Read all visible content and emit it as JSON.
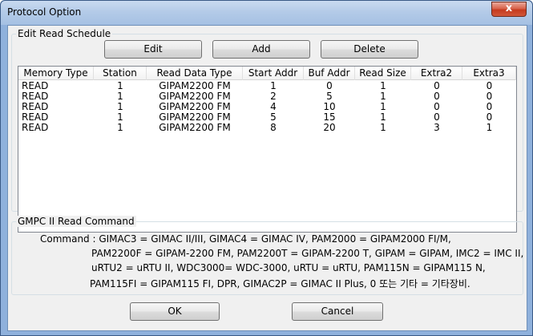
{
  "window": {
    "title": "Protocol Option",
    "close_label": "x"
  },
  "schedule": {
    "group_label": "Edit Read Schedule",
    "buttons": {
      "edit": "Edit",
      "add": "Add",
      "delete": "Delete"
    },
    "columns": [
      "Memory Type",
      "Station",
      "Read Data Type",
      "Start Addr",
      "Buf Addr",
      "Read Size",
      "Extra2",
      "Extra3"
    ],
    "rows": [
      [
        "READ",
        "1",
        "GIPAM2200 FM",
        "1",
        "0",
        "1",
        "0",
        "0"
      ],
      [
        "READ",
        "1",
        "GIPAM2200 FM",
        "2",
        "5",
        "1",
        "0",
        "0"
      ],
      [
        "READ",
        "1",
        "GIPAM2200 FM",
        "4",
        "10",
        "1",
        "0",
        "0"
      ],
      [
        "READ",
        "1",
        "GIPAM2200 FM",
        "5",
        "15",
        "1",
        "0",
        "0"
      ],
      [
        "READ",
        "1",
        "GIPAM2200 FM",
        "8",
        "20",
        "1",
        "3",
        "1"
      ]
    ]
  },
  "command": {
    "group_label": "GMPC II  Read Command",
    "lines": [
      "Command : GIMAC3 = GIMAC II/III, GIMAC4 = GIMAC IV, PAM2000 = GIPAM2000 FI/M,",
      "PAM2200F = GIPAM-2200 FM, PAM2200T = GIPAM-2200 T,  GIPAM = GIPAM, IMC2 = IMC II,",
      "uRTU2 = uRTU II, WDC3000= WDC-3000, uRTU = uRTU, PAM115N = GIPAM115 N,",
      "PAM115FI = GIPAM115 FI, DPR, GIMAC2P = GIMAC II Plus, 0 또는 기타 = 기타장비."
    ]
  },
  "footer": {
    "ok": "OK",
    "cancel": "Cancel"
  }
}
